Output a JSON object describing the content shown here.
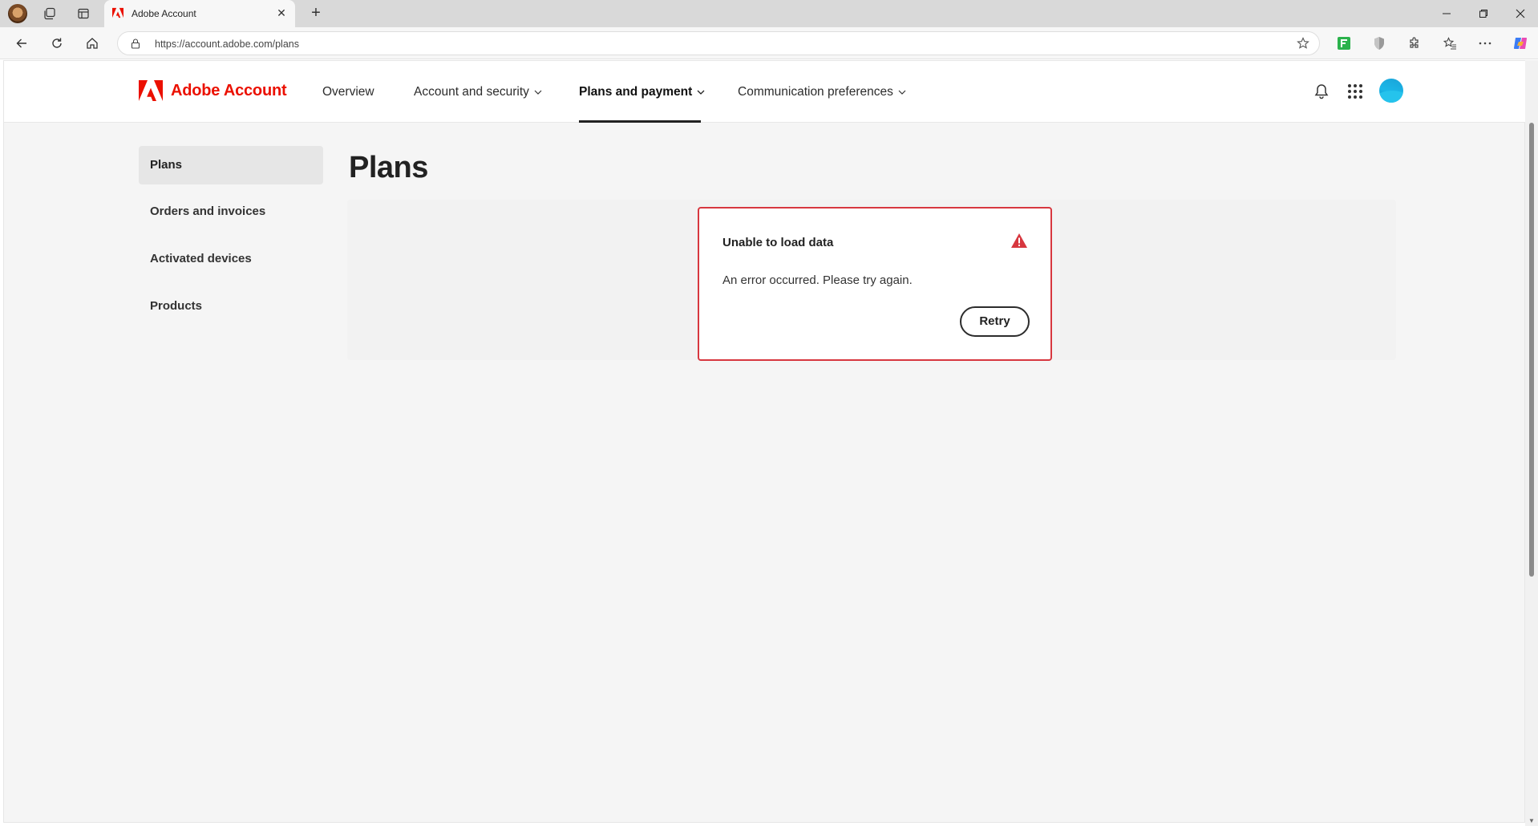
{
  "browser": {
    "tab_title": "Adobe Account",
    "new_tab_symbol": "+",
    "url": "https://account.adobe.com/plans",
    "window_controls": [
      "minimize-icon",
      "restore-icon",
      "close-icon"
    ]
  },
  "header": {
    "brand": "Adobe Account",
    "brand_color": "#eb1000",
    "nav": {
      "overview": "Overview",
      "account_security": "Account and security",
      "plans_payment": "Plans and payment",
      "communication": "Communication preferences"
    },
    "active_nav": "Plans and payment"
  },
  "sidebar": {
    "items": [
      "Plans",
      "Orders and invoices",
      "Activated devices",
      "Products"
    ],
    "selected": "Plans"
  },
  "main": {
    "title": "Plans",
    "error": {
      "title": "Unable to load data",
      "message": "An error occurred. Please try again.",
      "retry_label": "Retry",
      "accent": "#d7373f"
    }
  }
}
